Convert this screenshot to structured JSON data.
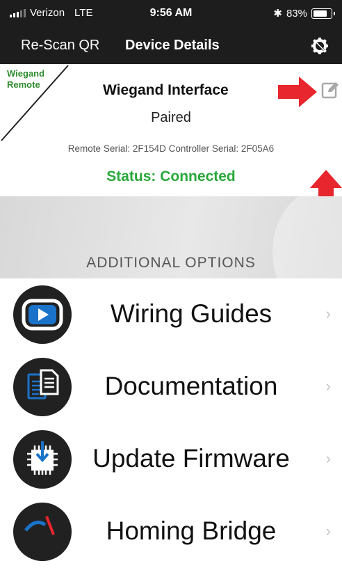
{
  "status_bar": {
    "carrier": "Verizon",
    "network": "LTE",
    "time": "9:56 AM",
    "bluetooth": "✱",
    "battery_pct": "83%"
  },
  "nav": {
    "back_label": "Re-Scan QR",
    "title": "Device Details",
    "settings_icon": "gear-wrench-icon"
  },
  "device": {
    "corner_label_line1": "Wiegand",
    "corner_label_line2": "Remote",
    "name": "Wiegand Interface",
    "state": "Paired",
    "serials": "Remote Serial: 2F154D  Controller Serial: 2F05A6",
    "status": "Status: Connected",
    "status_color": "#28a83a",
    "edit_icon": "edit-pencil-icon",
    "annotation_color": "#e8262d"
  },
  "options": {
    "heading": "ADDITIONAL OPTIONS",
    "items": [
      {
        "label": "Wiring Guides",
        "icon": "play-video-icon"
      },
      {
        "label": "Documentation",
        "icon": "documents-icon"
      },
      {
        "label": "Update Firmware",
        "icon": "chip-download-icon"
      },
      {
        "label": "Homing Bridge",
        "icon": "bridge-icon"
      }
    ],
    "chevron": "›"
  }
}
